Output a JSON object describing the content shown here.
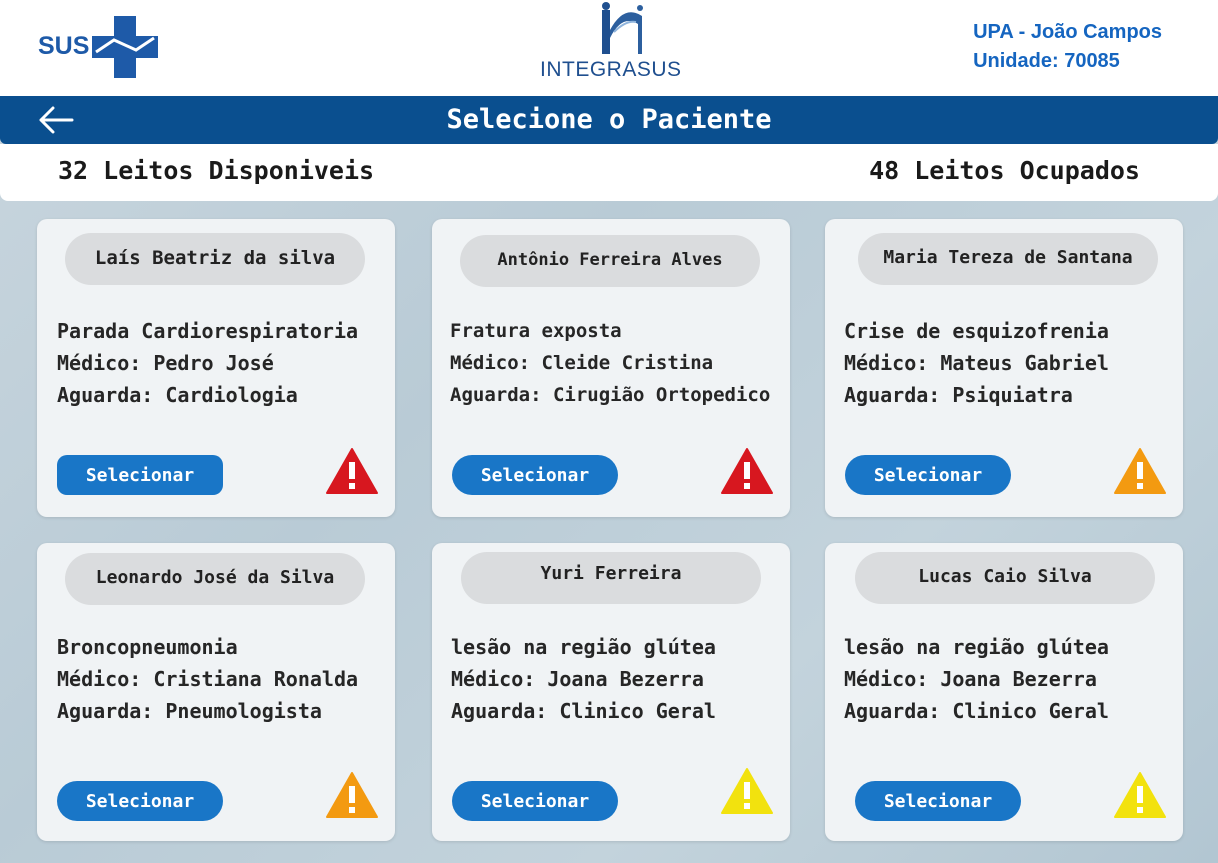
{
  "header": {
    "sus_logo_text": "SUS",
    "integrasus_logo_text": "INTEGRASUS",
    "unit_name": "UPA - João Campos",
    "unit_code": "Unidade: 70085"
  },
  "titlebar": {
    "title": "Selecione o Paciente",
    "back_icon": "arrow-left-icon"
  },
  "stats": {
    "available": "32 Leitos Disponiveis",
    "occupied": "48 Leitos Ocupados"
  },
  "patients": [
    {
      "name": "Laís Beatriz da silva",
      "condition": "Parada Cardiorespiratoria",
      "doctor": "Médico: Pedro José",
      "awaiting": "Aguarda: Cardiologia",
      "button": "Selecionar",
      "priority": "red",
      "priority_color": "#d7171f"
    },
    {
      "name": "Antônio Ferreira Alves",
      "condition": "Fratura exposta",
      "doctor": "Médico: Cleide Cristina",
      "awaiting": "Aguarda: Cirugião Ortopedico",
      "button": "Selecionar",
      "priority": "red",
      "priority_color": "#d7171f"
    },
    {
      "name": "Maria Tereza de Santana",
      "condition": "Crise de esquizofrenia",
      "doctor": "Médico: Mateus Gabriel",
      "awaiting": "Aguarda: Psiquiatra",
      "button": "Selecionar",
      "priority": "orange",
      "priority_color": "#f39a11"
    },
    {
      "name": "Leonardo José da Silva",
      "condition": "Broncopneumonia",
      "doctor": "Médico: Cristiana Ronalda",
      "awaiting": "Aguarda: Pneumologista",
      "button": "Selecionar",
      "priority": "orange",
      "priority_color": "#f39a11"
    },
    {
      "name": "Yuri Ferreira",
      "condition": "lesão na região glútea",
      "doctor": "Médico: Joana Bezerra",
      "awaiting": "Aguarda: Clinico Geral",
      "button": "Selecionar",
      "priority": "yellow",
      "priority_color": "#f2e20e"
    },
    {
      "name": "Lucas Caio Silva",
      "condition": "lesão na região glútea",
      "doctor": "Médico: Joana Bezerra",
      "awaiting": "Aguarda: Clinico Geral",
      "button": "Selecionar",
      "priority": "yellow",
      "priority_color": "#f2e20e"
    }
  ],
  "colors": {
    "brand_blue": "#0a4f8f",
    "button_blue": "#1976c7"
  }
}
